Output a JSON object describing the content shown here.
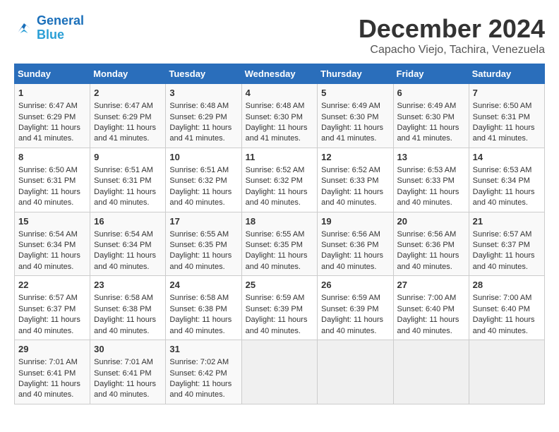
{
  "logo": {
    "line1": "General",
    "line2": "Blue"
  },
  "title": "December 2024",
  "location": "Capacho Viejo, Tachira, Venezuela",
  "weekdays": [
    "Sunday",
    "Monday",
    "Tuesday",
    "Wednesday",
    "Thursday",
    "Friday",
    "Saturday"
  ],
  "weeks": [
    [
      {
        "day": "1",
        "sunrise": "6:47 AM",
        "sunset": "6:29 PM",
        "daylight": "11 hours and 41 minutes."
      },
      {
        "day": "2",
        "sunrise": "6:47 AM",
        "sunset": "6:29 PM",
        "daylight": "11 hours and 41 minutes."
      },
      {
        "day": "3",
        "sunrise": "6:48 AM",
        "sunset": "6:29 PM",
        "daylight": "11 hours and 41 minutes."
      },
      {
        "day": "4",
        "sunrise": "6:48 AM",
        "sunset": "6:30 PM",
        "daylight": "11 hours and 41 minutes."
      },
      {
        "day": "5",
        "sunrise": "6:49 AM",
        "sunset": "6:30 PM",
        "daylight": "11 hours and 41 minutes."
      },
      {
        "day": "6",
        "sunrise": "6:49 AM",
        "sunset": "6:30 PM",
        "daylight": "11 hours and 41 minutes."
      },
      {
        "day": "7",
        "sunrise": "6:50 AM",
        "sunset": "6:31 PM",
        "daylight": "11 hours and 41 minutes."
      }
    ],
    [
      {
        "day": "8",
        "sunrise": "6:50 AM",
        "sunset": "6:31 PM",
        "daylight": "11 hours and 40 minutes."
      },
      {
        "day": "9",
        "sunrise": "6:51 AM",
        "sunset": "6:31 PM",
        "daylight": "11 hours and 40 minutes."
      },
      {
        "day": "10",
        "sunrise": "6:51 AM",
        "sunset": "6:32 PM",
        "daylight": "11 hours and 40 minutes."
      },
      {
        "day": "11",
        "sunrise": "6:52 AM",
        "sunset": "6:32 PM",
        "daylight": "11 hours and 40 minutes."
      },
      {
        "day": "12",
        "sunrise": "6:52 AM",
        "sunset": "6:33 PM",
        "daylight": "11 hours and 40 minutes."
      },
      {
        "day": "13",
        "sunrise": "6:53 AM",
        "sunset": "6:33 PM",
        "daylight": "11 hours and 40 minutes."
      },
      {
        "day": "14",
        "sunrise": "6:53 AM",
        "sunset": "6:34 PM",
        "daylight": "11 hours and 40 minutes."
      }
    ],
    [
      {
        "day": "15",
        "sunrise": "6:54 AM",
        "sunset": "6:34 PM",
        "daylight": "11 hours and 40 minutes."
      },
      {
        "day": "16",
        "sunrise": "6:54 AM",
        "sunset": "6:34 PM",
        "daylight": "11 hours and 40 minutes."
      },
      {
        "day": "17",
        "sunrise": "6:55 AM",
        "sunset": "6:35 PM",
        "daylight": "11 hours and 40 minutes."
      },
      {
        "day": "18",
        "sunrise": "6:55 AM",
        "sunset": "6:35 PM",
        "daylight": "11 hours and 40 minutes."
      },
      {
        "day": "19",
        "sunrise": "6:56 AM",
        "sunset": "6:36 PM",
        "daylight": "11 hours and 40 minutes."
      },
      {
        "day": "20",
        "sunrise": "6:56 AM",
        "sunset": "6:36 PM",
        "daylight": "11 hours and 40 minutes."
      },
      {
        "day": "21",
        "sunrise": "6:57 AM",
        "sunset": "6:37 PM",
        "daylight": "11 hours and 40 minutes."
      }
    ],
    [
      {
        "day": "22",
        "sunrise": "6:57 AM",
        "sunset": "6:37 PM",
        "daylight": "11 hours and 40 minutes."
      },
      {
        "day": "23",
        "sunrise": "6:58 AM",
        "sunset": "6:38 PM",
        "daylight": "11 hours and 40 minutes."
      },
      {
        "day": "24",
        "sunrise": "6:58 AM",
        "sunset": "6:38 PM",
        "daylight": "11 hours and 40 minutes."
      },
      {
        "day": "25",
        "sunrise": "6:59 AM",
        "sunset": "6:39 PM",
        "daylight": "11 hours and 40 minutes."
      },
      {
        "day": "26",
        "sunrise": "6:59 AM",
        "sunset": "6:39 PM",
        "daylight": "11 hours and 40 minutes."
      },
      {
        "day": "27",
        "sunrise": "7:00 AM",
        "sunset": "6:40 PM",
        "daylight": "11 hours and 40 minutes."
      },
      {
        "day": "28",
        "sunrise": "7:00 AM",
        "sunset": "6:40 PM",
        "daylight": "11 hours and 40 minutes."
      }
    ],
    [
      {
        "day": "29",
        "sunrise": "7:01 AM",
        "sunset": "6:41 PM",
        "daylight": "11 hours and 40 minutes."
      },
      {
        "day": "30",
        "sunrise": "7:01 AM",
        "sunset": "6:41 PM",
        "daylight": "11 hours and 40 minutes."
      },
      {
        "day": "31",
        "sunrise": "7:02 AM",
        "sunset": "6:42 PM",
        "daylight": "11 hours and 40 minutes."
      },
      null,
      null,
      null,
      null
    ]
  ],
  "labels": {
    "sunrise": "Sunrise: ",
    "sunset": "Sunset: ",
    "daylight": "Daylight: "
  }
}
